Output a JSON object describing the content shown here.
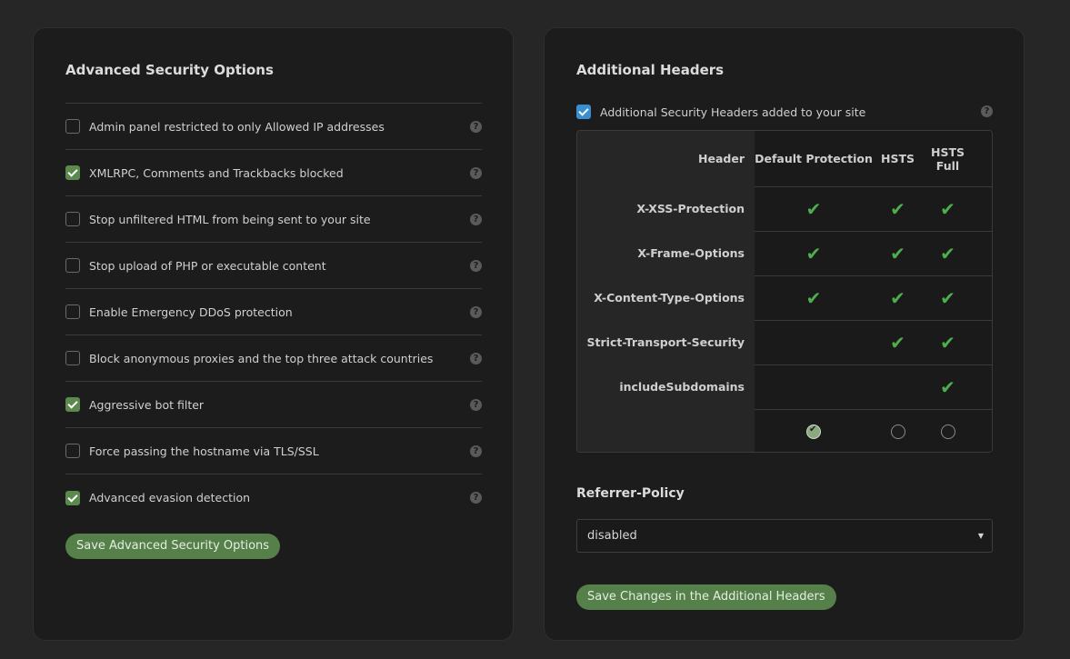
{
  "advanced": {
    "title": "Advanced Security Options",
    "options": [
      {
        "label": "Admin panel restricted to only Allowed IP addresses",
        "checked": false
      },
      {
        "label": "XMLRPC, Comments and Trackbacks blocked",
        "checked": true
      },
      {
        "label": "Stop unfiltered HTML from being sent to your site",
        "checked": false
      },
      {
        "label": "Stop upload of PHP or executable content",
        "checked": false
      },
      {
        "label": "Enable Emergency DDoS protection",
        "checked": false
      },
      {
        "label": "Block anonymous proxies and the top three attack countries",
        "checked": false
      },
      {
        "label": "Aggressive bot filter",
        "checked": true
      },
      {
        "label": "Force passing the hostname via TLS/SSL",
        "checked": false
      },
      {
        "label": "Advanced evasion detection",
        "checked": true
      }
    ],
    "help_glyph": "?",
    "save_label": "Save Advanced Security Options"
  },
  "headers": {
    "title": "Additional Headers",
    "toggle_label": "Additional Security Headers added to your site",
    "toggle_checked": true,
    "table": {
      "col_header": "Header",
      "col_default": "Default Protection",
      "col_hsts": "HSTS",
      "col_hsts_full": "HSTS Full",
      "rows": [
        {
          "name": "X-XSS-Protection",
          "default": true,
          "hsts": true,
          "full": true
        },
        {
          "name": "X-Frame-Options",
          "default": true,
          "hsts": true,
          "full": true
        },
        {
          "name": "X-Content-Type-Options",
          "default": true,
          "hsts": true,
          "full": true
        },
        {
          "name": "Strict-Transport-Security",
          "default": false,
          "hsts": true,
          "full": true
        },
        {
          "name": "includeSubdomains",
          "default": false,
          "hsts": false,
          "full": true
        }
      ],
      "selected": "default"
    },
    "check_glyph": "✔",
    "referrer_title": "Referrer-Policy",
    "referrer_value": "disabled",
    "select_arrow": "▼",
    "save_label": "Save Changes in the Additional Headers"
  },
  "colors": {
    "background": "#262626",
    "card": "#1c1c1c",
    "accent_green": "#56804a",
    "check_green": "#4cae4c",
    "checkbox_blue": "#3a8fd0"
  }
}
